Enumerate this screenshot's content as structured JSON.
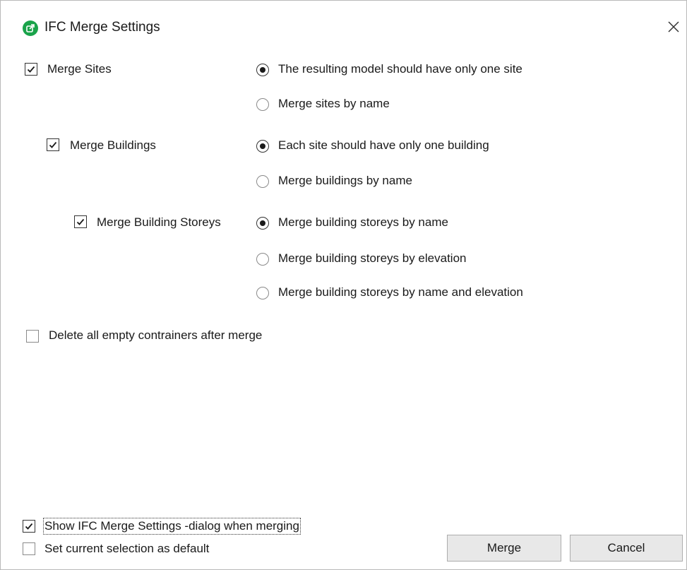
{
  "window": {
    "title": "IFC Merge Settings",
    "icon": "ifc-merge-app-icon",
    "close_icon": "close-icon"
  },
  "options": {
    "merge_sites": {
      "label": "Merge Sites",
      "checked": true,
      "radios": [
        {
          "label": "The resulting model should have only one site",
          "selected": true
        },
        {
          "label": "Merge sites by name",
          "selected": false
        }
      ]
    },
    "merge_buildings": {
      "label": "Merge Buildings",
      "checked": true,
      "radios": [
        {
          "label": "Each site should have only one building",
          "selected": true
        },
        {
          "label": "Merge buildings by name",
          "selected": false
        }
      ]
    },
    "merge_storeys": {
      "label": "Merge Building Storeys",
      "checked": true,
      "radios": [
        {
          "label": "Merge building storeys by name",
          "selected": true
        },
        {
          "label": "Merge building storeys by elevation",
          "selected": false
        },
        {
          "label": "Merge building storeys by name and elevation",
          "selected": false
        }
      ]
    },
    "delete_empty": {
      "label": "Delete all empty contrainers after merge",
      "checked": false
    }
  },
  "footer": {
    "show_dialog": {
      "label": "Show IFC Merge Settings -dialog when merging",
      "checked": true
    },
    "set_default": {
      "label": "Set current selection as default",
      "checked": false
    },
    "merge_button": "Merge",
    "cancel_button": "Cancel"
  }
}
